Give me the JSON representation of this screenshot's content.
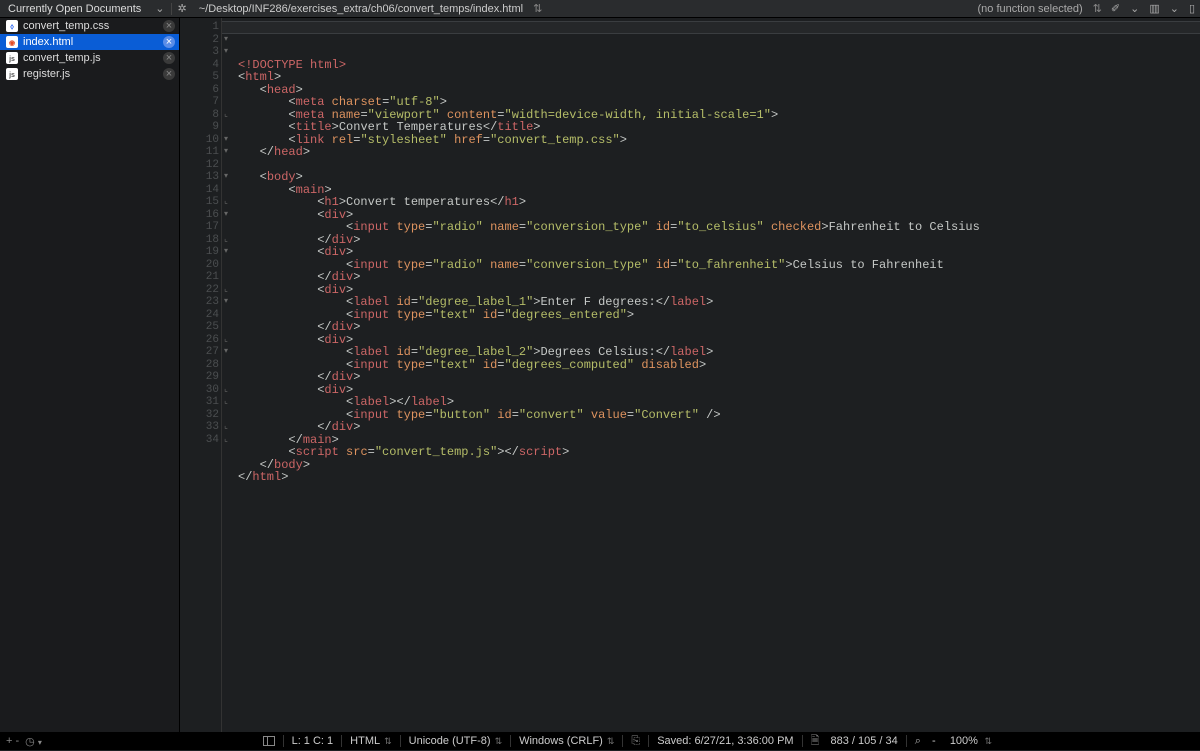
{
  "topbar": {
    "docs_label": "Currently Open Documents",
    "path": "~/Desktop/INF286/exercises_extra/ch06/convert_temps/index.html",
    "func_label": "(no function selected)"
  },
  "sidebar": {
    "files": [
      {
        "name": "convert_temp.css",
        "active": false,
        "type": "css"
      },
      {
        "name": "index.html",
        "active": true,
        "type": "html"
      },
      {
        "name": "convert_temp.js",
        "active": false,
        "type": "js"
      },
      {
        "name": "register.js",
        "active": false,
        "type": "js"
      }
    ]
  },
  "editor": {
    "lines": [
      {
        "n": 1,
        "fold": "",
        "tokens": [
          [
            "doctype",
            "<!DOCTYPE html>"
          ]
        ]
      },
      {
        "n": 2,
        "fold": "▾",
        "tokens": [
          [
            "bracket",
            "<"
          ],
          [
            "tag",
            "html"
          ],
          [
            "bracket",
            ">"
          ]
        ]
      },
      {
        "n": 3,
        "fold": "▾",
        "tokens": [
          [
            "text",
            "   "
          ],
          [
            "bracket",
            "<"
          ],
          [
            "tag",
            "head"
          ],
          [
            "bracket",
            ">"
          ]
        ]
      },
      {
        "n": 4,
        "fold": "",
        "tokens": [
          [
            "text",
            "       "
          ],
          [
            "bracket",
            "<"
          ],
          [
            "tag",
            "meta"
          ],
          [
            "text",
            " "
          ],
          [
            "attr",
            "charset"
          ],
          [
            "bracket",
            "="
          ],
          [
            "string",
            "\"utf-8\""
          ],
          [
            "bracket",
            ">"
          ]
        ]
      },
      {
        "n": 5,
        "fold": "",
        "tokens": [
          [
            "text",
            "       "
          ],
          [
            "bracket",
            "<"
          ],
          [
            "tag",
            "meta"
          ],
          [
            "text",
            " "
          ],
          [
            "attr",
            "name"
          ],
          [
            "bracket",
            "="
          ],
          [
            "string",
            "\"viewport\""
          ],
          [
            "text",
            " "
          ],
          [
            "attr",
            "content"
          ],
          [
            "bracket",
            "="
          ],
          [
            "string",
            "\"width=device-width, initial-scale=1\""
          ],
          [
            "bracket",
            ">"
          ]
        ]
      },
      {
        "n": 6,
        "fold": "",
        "tokens": [
          [
            "text",
            "       "
          ],
          [
            "bracket",
            "<"
          ],
          [
            "tag",
            "title"
          ],
          [
            "bracket",
            ">"
          ],
          [
            "text",
            "Convert Temperatures"
          ],
          [
            "bracket",
            "</"
          ],
          [
            "tag",
            "title"
          ],
          [
            "bracket",
            ">"
          ]
        ]
      },
      {
        "n": 7,
        "fold": "",
        "tokens": [
          [
            "text",
            "       "
          ],
          [
            "bracket",
            "<"
          ],
          [
            "tag",
            "link"
          ],
          [
            "text",
            " "
          ],
          [
            "attr",
            "rel"
          ],
          [
            "bracket",
            "="
          ],
          [
            "string",
            "\"stylesheet\""
          ],
          [
            "text",
            " "
          ],
          [
            "attr",
            "href"
          ],
          [
            "bracket",
            "="
          ],
          [
            "string",
            "\"convert_temp.css\""
          ],
          [
            "bracket",
            ">"
          ]
        ]
      },
      {
        "n": 8,
        "fold": "⌞",
        "tokens": [
          [
            "text",
            "   "
          ],
          [
            "bracket",
            "</"
          ],
          [
            "tag",
            "head"
          ],
          [
            "bracket",
            ">"
          ]
        ]
      },
      {
        "n": 9,
        "fold": "",
        "tokens": [
          [
            "text",
            ""
          ]
        ]
      },
      {
        "n": 10,
        "fold": "▾",
        "tokens": [
          [
            "text",
            "   "
          ],
          [
            "bracket",
            "<"
          ],
          [
            "tag",
            "body"
          ],
          [
            "bracket",
            ">"
          ]
        ]
      },
      {
        "n": 11,
        "fold": "▾",
        "tokens": [
          [
            "text",
            "       "
          ],
          [
            "bracket",
            "<"
          ],
          [
            "tag",
            "main"
          ],
          [
            "bracket",
            ">"
          ]
        ]
      },
      {
        "n": 12,
        "fold": "",
        "tokens": [
          [
            "text",
            "           "
          ],
          [
            "bracket",
            "<"
          ],
          [
            "tag",
            "h1"
          ],
          [
            "bracket",
            ">"
          ],
          [
            "text",
            "Convert temperatures"
          ],
          [
            "bracket",
            "</"
          ],
          [
            "tag",
            "h1"
          ],
          [
            "bracket",
            ">"
          ]
        ]
      },
      {
        "n": 13,
        "fold": "▾",
        "tokens": [
          [
            "text",
            "           "
          ],
          [
            "bracket",
            "<"
          ],
          [
            "tag",
            "div"
          ],
          [
            "bracket",
            ">"
          ]
        ]
      },
      {
        "n": 14,
        "fold": "",
        "tokens": [
          [
            "text",
            "               "
          ],
          [
            "bracket",
            "<"
          ],
          [
            "tag",
            "input"
          ],
          [
            "text",
            " "
          ],
          [
            "attr",
            "type"
          ],
          [
            "bracket",
            "="
          ],
          [
            "string",
            "\"radio\""
          ],
          [
            "text",
            " "
          ],
          [
            "attr",
            "name"
          ],
          [
            "bracket",
            "="
          ],
          [
            "string",
            "\"conversion_type\""
          ],
          [
            "text",
            " "
          ],
          [
            "attr",
            "id"
          ],
          [
            "bracket",
            "="
          ],
          [
            "string",
            "\"to_celsius\""
          ],
          [
            "text",
            " "
          ],
          [
            "attr",
            "checked"
          ],
          [
            "bracket",
            ">"
          ],
          [
            "text",
            "Fahrenheit to Celsius"
          ]
        ]
      },
      {
        "n": 15,
        "fold": "⌞",
        "tokens": [
          [
            "text",
            "           "
          ],
          [
            "bracket",
            "</"
          ],
          [
            "tag",
            "div"
          ],
          [
            "bracket",
            ">"
          ]
        ]
      },
      {
        "n": 16,
        "fold": "▾",
        "tokens": [
          [
            "text",
            "           "
          ],
          [
            "bracket",
            "<"
          ],
          [
            "tag",
            "div"
          ],
          [
            "bracket",
            ">"
          ]
        ]
      },
      {
        "n": 17,
        "fold": "",
        "tokens": [
          [
            "text",
            "               "
          ],
          [
            "bracket",
            "<"
          ],
          [
            "tag",
            "input"
          ],
          [
            "text",
            " "
          ],
          [
            "attr",
            "type"
          ],
          [
            "bracket",
            "="
          ],
          [
            "string",
            "\"radio\""
          ],
          [
            "text",
            " "
          ],
          [
            "attr",
            "name"
          ],
          [
            "bracket",
            "="
          ],
          [
            "string",
            "\"conversion_type\""
          ],
          [
            "text",
            " "
          ],
          [
            "attr",
            "id"
          ],
          [
            "bracket",
            "="
          ],
          [
            "string",
            "\"to_fahrenheit\""
          ],
          [
            "bracket",
            ">"
          ],
          [
            "text",
            "Celsius to Fahrenheit"
          ]
        ]
      },
      {
        "n": 18,
        "fold": "⌞",
        "tokens": [
          [
            "text",
            "           "
          ],
          [
            "bracket",
            "</"
          ],
          [
            "tag",
            "div"
          ],
          [
            "bracket",
            ">"
          ]
        ]
      },
      {
        "n": 19,
        "fold": "▾",
        "tokens": [
          [
            "text",
            "           "
          ],
          [
            "bracket",
            "<"
          ],
          [
            "tag",
            "div"
          ],
          [
            "bracket",
            ">"
          ]
        ]
      },
      {
        "n": 20,
        "fold": "",
        "tokens": [
          [
            "text",
            "               "
          ],
          [
            "bracket",
            "<"
          ],
          [
            "tag",
            "label"
          ],
          [
            "text",
            " "
          ],
          [
            "attr",
            "id"
          ],
          [
            "bracket",
            "="
          ],
          [
            "string",
            "\"degree_label_1\""
          ],
          [
            "bracket",
            ">"
          ],
          [
            "text",
            "Enter F degrees:"
          ],
          [
            "bracket",
            "</"
          ],
          [
            "tag",
            "label"
          ],
          [
            "bracket",
            ">"
          ]
        ]
      },
      {
        "n": 21,
        "fold": "",
        "tokens": [
          [
            "text",
            "               "
          ],
          [
            "bracket",
            "<"
          ],
          [
            "tag",
            "input"
          ],
          [
            "text",
            " "
          ],
          [
            "attr",
            "type"
          ],
          [
            "bracket",
            "="
          ],
          [
            "string",
            "\"text\""
          ],
          [
            "text",
            " "
          ],
          [
            "attr",
            "id"
          ],
          [
            "bracket",
            "="
          ],
          [
            "string",
            "\"degrees_entered\""
          ],
          [
            "bracket",
            ">"
          ]
        ]
      },
      {
        "n": 22,
        "fold": "⌞",
        "tokens": [
          [
            "text",
            "           "
          ],
          [
            "bracket",
            "</"
          ],
          [
            "tag",
            "div"
          ],
          [
            "bracket",
            ">"
          ]
        ]
      },
      {
        "n": 23,
        "fold": "▾",
        "tokens": [
          [
            "text",
            "           "
          ],
          [
            "bracket",
            "<"
          ],
          [
            "tag",
            "div"
          ],
          [
            "bracket",
            ">"
          ]
        ]
      },
      {
        "n": 24,
        "fold": "",
        "tokens": [
          [
            "text",
            "               "
          ],
          [
            "bracket",
            "<"
          ],
          [
            "tag",
            "label"
          ],
          [
            "text",
            " "
          ],
          [
            "attr",
            "id"
          ],
          [
            "bracket",
            "="
          ],
          [
            "string",
            "\"degree_label_2\""
          ],
          [
            "bracket",
            ">"
          ],
          [
            "text",
            "Degrees Celsius:"
          ],
          [
            "bracket",
            "</"
          ],
          [
            "tag",
            "label"
          ],
          [
            "bracket",
            ">"
          ]
        ]
      },
      {
        "n": 25,
        "fold": "",
        "tokens": [
          [
            "text",
            "               "
          ],
          [
            "bracket",
            "<"
          ],
          [
            "tag",
            "input"
          ],
          [
            "text",
            " "
          ],
          [
            "attr",
            "type"
          ],
          [
            "bracket",
            "="
          ],
          [
            "string",
            "\"text\""
          ],
          [
            "text",
            " "
          ],
          [
            "attr",
            "id"
          ],
          [
            "bracket",
            "="
          ],
          [
            "string",
            "\"degrees_computed\""
          ],
          [
            "text",
            " "
          ],
          [
            "attr",
            "disabled"
          ],
          [
            "bracket",
            ">"
          ]
        ]
      },
      {
        "n": 26,
        "fold": "⌞",
        "tokens": [
          [
            "text",
            "           "
          ],
          [
            "bracket",
            "</"
          ],
          [
            "tag",
            "div"
          ],
          [
            "bracket",
            ">"
          ]
        ]
      },
      {
        "n": 27,
        "fold": "▾",
        "tokens": [
          [
            "text",
            "           "
          ],
          [
            "bracket",
            "<"
          ],
          [
            "tag",
            "div"
          ],
          [
            "bracket",
            ">"
          ]
        ]
      },
      {
        "n": 28,
        "fold": "",
        "tokens": [
          [
            "text",
            "               "
          ],
          [
            "bracket",
            "<"
          ],
          [
            "tag",
            "label"
          ],
          [
            "bracket",
            ">"
          ],
          [
            "bracket",
            "</"
          ],
          [
            "tag",
            "label"
          ],
          [
            "bracket",
            ">"
          ]
        ]
      },
      {
        "n": 29,
        "fold": "",
        "tokens": [
          [
            "text",
            "               "
          ],
          [
            "bracket",
            "<"
          ],
          [
            "tag",
            "input"
          ],
          [
            "text",
            " "
          ],
          [
            "attr",
            "type"
          ],
          [
            "bracket",
            "="
          ],
          [
            "string",
            "\"button\""
          ],
          [
            "text",
            " "
          ],
          [
            "attr",
            "id"
          ],
          [
            "bracket",
            "="
          ],
          [
            "string",
            "\"convert\""
          ],
          [
            "text",
            " "
          ],
          [
            "attr",
            "value"
          ],
          [
            "bracket",
            "="
          ],
          [
            "string",
            "\"Convert\""
          ],
          [
            "text",
            " "
          ],
          [
            "bracket",
            "/>"
          ]
        ]
      },
      {
        "n": 30,
        "fold": "⌞",
        "tokens": [
          [
            "text",
            "           "
          ],
          [
            "bracket",
            "</"
          ],
          [
            "tag",
            "div"
          ],
          [
            "bracket",
            ">"
          ]
        ]
      },
      {
        "n": 31,
        "fold": "⌞",
        "tokens": [
          [
            "text",
            "       "
          ],
          [
            "bracket",
            "</"
          ],
          [
            "tag",
            "main"
          ],
          [
            "bracket",
            ">"
          ]
        ]
      },
      {
        "n": 32,
        "fold": "",
        "tokens": [
          [
            "text",
            "       "
          ],
          [
            "bracket",
            "<"
          ],
          [
            "tag",
            "script"
          ],
          [
            "text",
            " "
          ],
          [
            "attr",
            "src"
          ],
          [
            "bracket",
            "="
          ],
          [
            "string",
            "\"convert_temp.js\""
          ],
          [
            "bracket",
            ">"
          ],
          [
            "bracket",
            "</"
          ],
          [
            "tag",
            "script"
          ],
          [
            "bracket",
            ">"
          ]
        ]
      },
      {
        "n": 33,
        "fold": "⌞",
        "tokens": [
          [
            "text",
            "   "
          ],
          [
            "bracket",
            "</"
          ],
          [
            "tag",
            "body"
          ],
          [
            "bracket",
            ">"
          ]
        ]
      },
      {
        "n": 34,
        "fold": "⌞",
        "tokens": [
          [
            "bracket",
            "</"
          ],
          [
            "tag",
            "html"
          ],
          [
            "bracket",
            ">"
          ]
        ]
      }
    ]
  },
  "status": {
    "cursor": "L: 1 C: 1",
    "lang": "HTML",
    "encoding": "Unicode (UTF-8)",
    "line_endings": "Windows (CRLF)",
    "saved": "Saved: 6/27/21, 3:36:00 PM",
    "counts": "883 / 105 / 34",
    "zoom_minus": "-",
    "zoom_pct": "100%"
  }
}
